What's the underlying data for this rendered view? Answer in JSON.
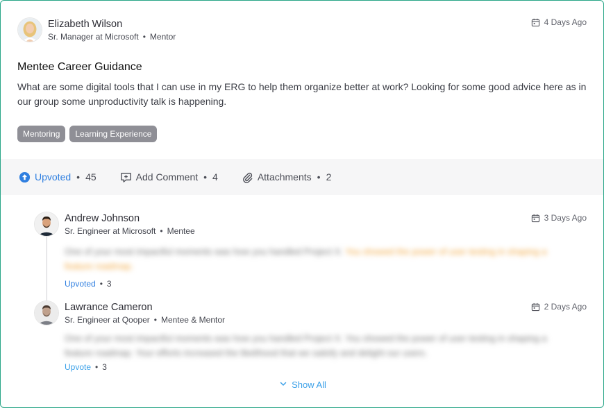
{
  "post": {
    "author": {
      "name": "Elizabeth Wilson",
      "title": "Sr. Manager at Microsoft",
      "role": "Mentor"
    },
    "time": "4 Days Ago",
    "title": "Mentee Career Guidance",
    "body": "What are some digital tools that I can use in my ERG to help them organize better at work? Looking for some good advice here as in our group some unproductivity talk is happening.",
    "tags": [
      "Mentoring",
      "Learning Experience"
    ]
  },
  "actions": {
    "upvote": {
      "label": "Upvoted",
      "count": "45"
    },
    "comment": {
      "label": "Add Comment",
      "count": "4"
    },
    "attachments": {
      "label": "Attachments",
      "count": "2"
    }
  },
  "comments": [
    {
      "name": "Andrew Johnson",
      "title": "Sr. Engineer at Microsoft",
      "role": "Mentee",
      "time": "3 Days Ago",
      "text_plain": "One of your most impactful moments was how you handled Project X.",
      "text_highlight": "You showed the power of user testing in shaping a feature roadmap.",
      "vote_label": "Upvoted",
      "vote_count": "3"
    },
    {
      "name": "Lawrance Cameron",
      "title": "Sr. Engineer at Qooper",
      "role": "Mentee & Mentor",
      "time": "2 Days Ago",
      "text_plain": "One of your most impactful moments was how you handled Project X. You showed the power of user testing in shaping a feature roadmap. Your efforts increased the likelihood that we satisfy and delight our users.",
      "vote_label": "Upvote",
      "vote_count": "3"
    }
  ],
  "show_all": "Show All",
  "colors": {
    "border": "#27a587",
    "accent_blue": "#2f7fe0",
    "link_blue": "#3aa0e8",
    "tag_bg": "#8f8f96",
    "highlight_orange": "#f0a43a"
  },
  "icons": {
    "calendar": "calendar-icon",
    "upvote": "upvote-arrow-icon",
    "comment": "add-comment-icon",
    "attachment": "paperclip-icon",
    "chevron": "chevron-down-icon"
  }
}
